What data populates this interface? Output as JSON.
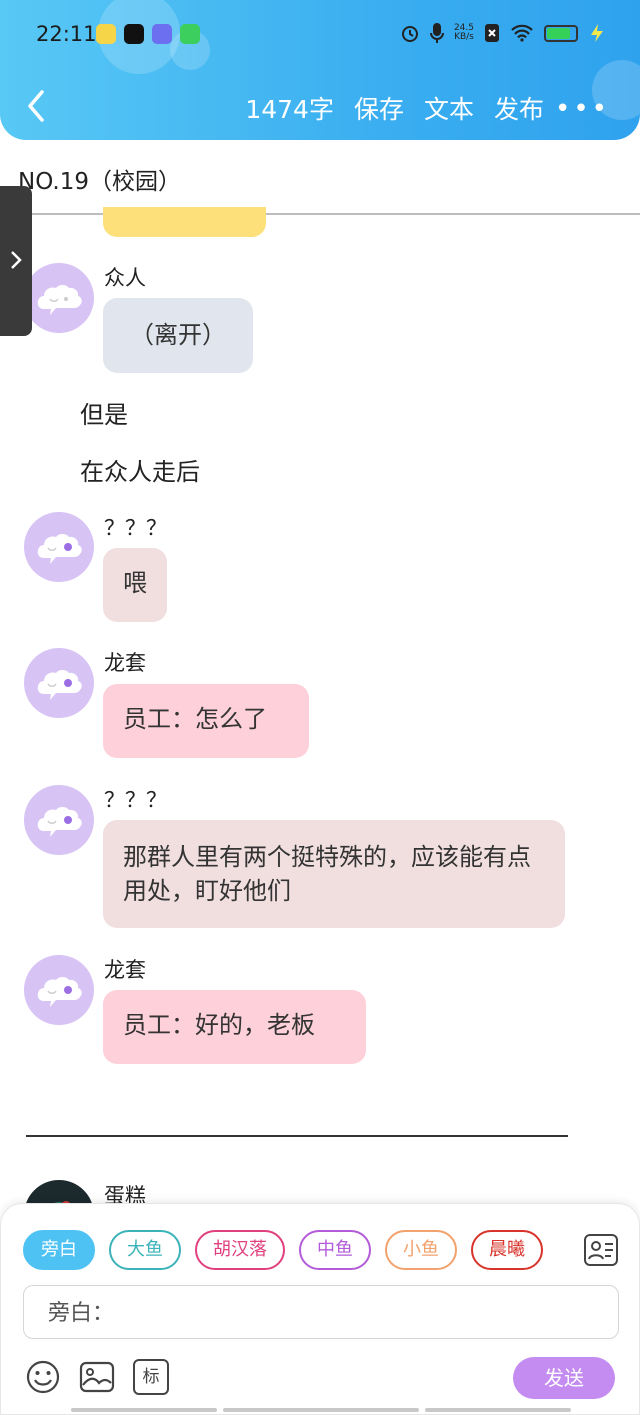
{
  "status_bar": {
    "time": "22:11",
    "net_speed_value": "24.5",
    "net_speed_unit": "KB/s",
    "battery_level": 0.75
  },
  "toolbar": {
    "word_count": "1474字",
    "save_label": "保存",
    "text_label": "文本",
    "publish_label": "发布",
    "more_label": "•••"
  },
  "document": {
    "title": "NO.19（校园）"
  },
  "messages": [
    {
      "speaker": "众人",
      "text": "（离开）",
      "bubble_color": "#e1e6ee"
    },
    {
      "narration": "但是"
    },
    {
      "narration": "在众人走后"
    },
    {
      "speaker": "？？？",
      "text": "喂",
      "bubble_color": "#f1dfe0"
    },
    {
      "speaker": "龙套",
      "text": "员工：怎么了",
      "bubble_color": "#fdd0da"
    },
    {
      "speaker": "？？？",
      "text": "那群人里有两个挺特殊的，应该能有点用处，盯好他们",
      "bubble_color": "#f1dfe0"
    },
    {
      "speaker": "龙套",
      "text": "员工：好的，老板",
      "bubble_color": "#fdd0da"
    },
    {
      "speaker": "蛋糕"
    }
  ],
  "panel": {
    "chips": [
      {
        "label": "旁白",
        "color": "#4ec3f3",
        "selected": true
      },
      {
        "label": "大鱼",
        "color": "#3bb3b8",
        "selected": false
      },
      {
        "label": "胡汉落",
        "color": "#e0407e",
        "selected": false
      },
      {
        "label": "中鱼",
        "color": "#b35bd8",
        "selected": false
      },
      {
        "label": "小鱼",
        "color": "#f2a26c",
        "selected": false
      },
      {
        "label": "晨曦",
        "color": "#d8342c",
        "selected": false
      }
    ],
    "input_placeholder": "旁白：",
    "tag_label": "标",
    "send_label": "发送"
  }
}
